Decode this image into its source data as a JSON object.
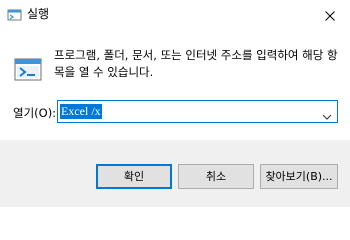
{
  "window": {
    "title": "실행",
    "title_icon": "run-dialog-icon",
    "close_icon": "close-icon"
  },
  "content": {
    "icon": "run-icon",
    "description": "프로그램, 폴더, 문서, 또는 인터넷 주소를 입력하여 해당 항목을 열 수 있습니다.",
    "open_label": "열기(O):",
    "open_value": "Excel /x",
    "dropdown_icon": "chevron-down-icon"
  },
  "buttons": {
    "ok": "확인",
    "cancel": "취소",
    "browse": "찾아보기(B)..."
  },
  "colors": {
    "accent": "#0078d7",
    "footer_bg": "#f0f0f0",
    "button_bg": "#e1e1e1"
  }
}
